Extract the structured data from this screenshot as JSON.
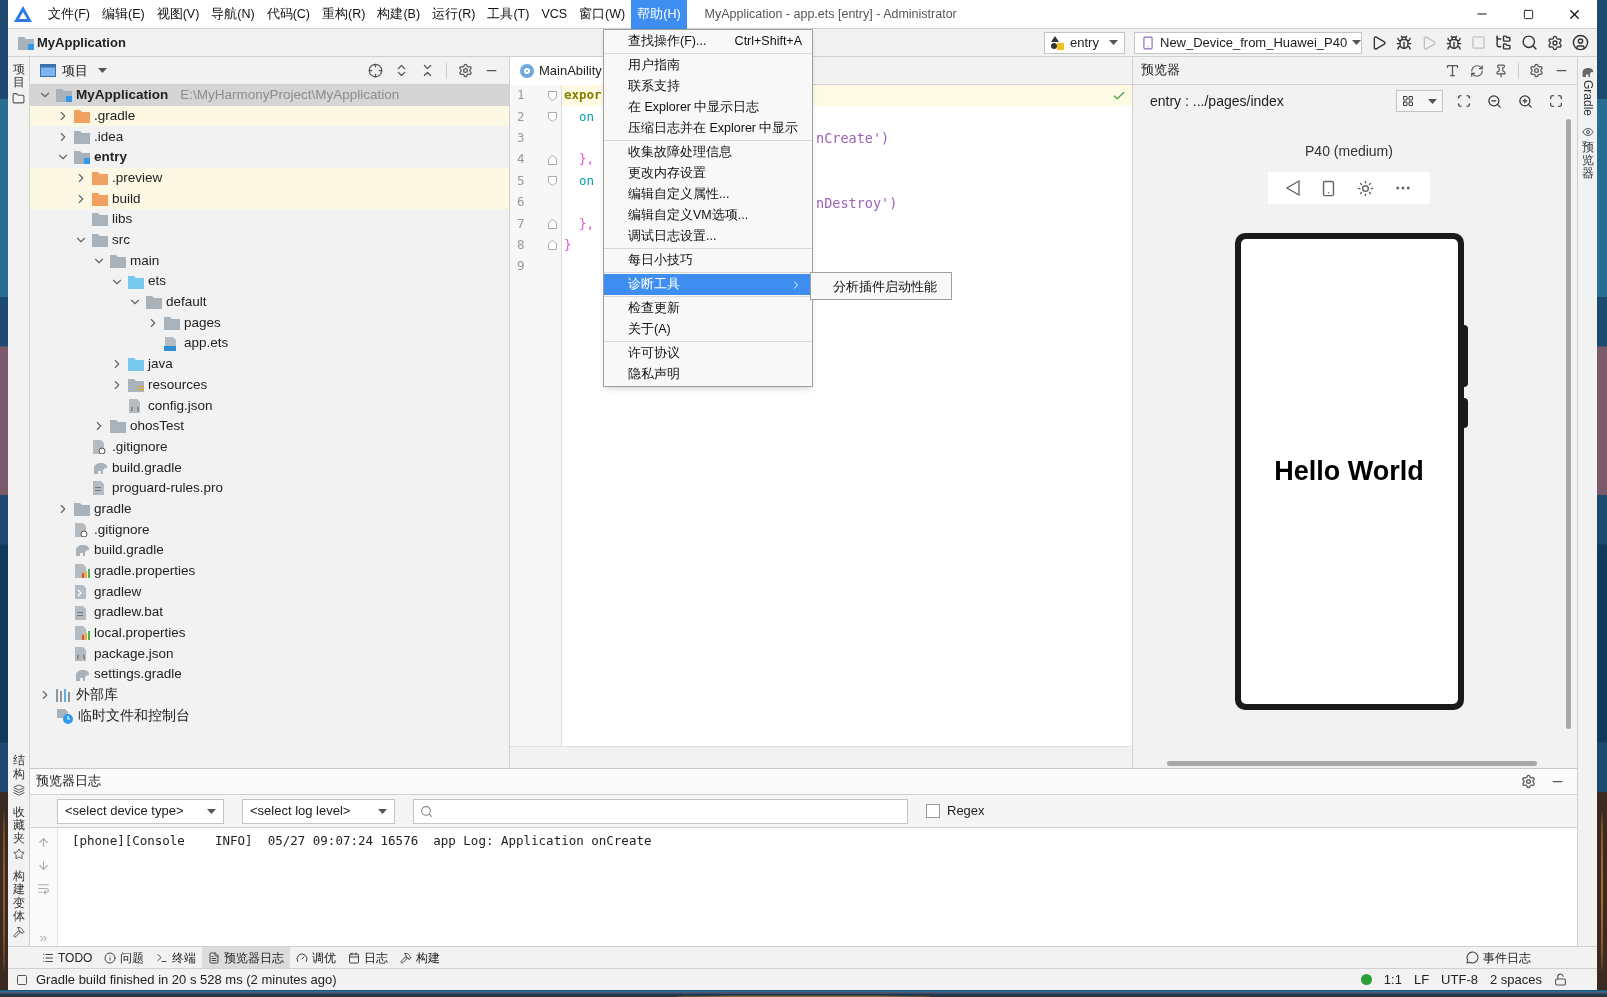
{
  "window": {
    "title": "MyApplication - app.ets [entry] - Administrator"
  },
  "menu_bar": [
    {
      "label": "文件(F)",
      "selected": false
    },
    {
      "label": "编辑(E)",
      "selected": false
    },
    {
      "label": "视图(V)",
      "selected": false
    },
    {
      "label": "导航(N)",
      "selected": false
    },
    {
      "label": "代码(C)",
      "selected": false
    },
    {
      "label": "重构(R)",
      "selected": false
    },
    {
      "label": "构建(B)",
      "selected": false
    },
    {
      "label": "运行(R)",
      "selected": false
    },
    {
      "label": "工具(T)",
      "selected": false
    },
    {
      "label": "VCS",
      "selected": false
    },
    {
      "label": "窗口(W)",
      "selected": false
    },
    {
      "label": "帮助(H)",
      "selected": true
    }
  ],
  "help_menu": [
    [
      {
        "label": "查找操作(F)...",
        "shortcut": "Ctrl+Shift+A",
        "selected": false
      }
    ],
    [
      {
        "label": "用户指南",
        "selected": false
      },
      {
        "label": "联系支持",
        "selected": false
      },
      {
        "label": "在 Explorer 中显示日志",
        "selected": false
      },
      {
        "label": "压缩日志并在 Explorer 中显示",
        "selected": false
      }
    ],
    [
      {
        "label": "收集故障处理信息",
        "selected": false
      },
      {
        "label": "更改内存设置",
        "selected": false
      },
      {
        "label": "编辑自定义属性...",
        "selected": false
      },
      {
        "label": "编辑自定义VM选项...",
        "selected": false
      },
      {
        "label": "调试日志设置...",
        "selected": false
      }
    ],
    [
      {
        "label": "每日小技巧",
        "selected": false
      }
    ],
    [
      {
        "label": "诊断工具",
        "selected": true,
        "submenu": [
          "分析插件启动性能"
        ]
      }
    ],
    [
      {
        "label": "检查更新",
        "selected": false
      },
      {
        "label": "关于(A)",
        "selected": false
      }
    ],
    [
      {
        "label": "许可协议",
        "selected": false
      },
      {
        "label": "隐私声明",
        "selected": false
      }
    ]
  ],
  "navigation": {
    "breadcrumb": "MyApplication",
    "module_selector": "entry",
    "device_selector": "New_Device_from_Huawei_P40"
  },
  "left_strip": [
    "项目",
    "结构",
    "收藏夹",
    "构建变体"
  ],
  "right_strip": [
    "Gradle",
    "预览器"
  ],
  "project_panel": {
    "title": "项目",
    "tree": [
      {
        "name": "MyApplication",
        "path": "E:\\MyHarmonyProject\\MyApplication",
        "kind": "module",
        "expanded": true,
        "selected": true,
        "excluded": false,
        "children": [
          {
            "name": ".gradle",
            "kind": "folder-excluded",
            "expanded": false,
            "selected": false,
            "excluded": true
          },
          {
            "name": ".idea",
            "kind": "folder",
            "expanded": false,
            "selected": false,
            "excluded": false
          },
          {
            "name": "entry",
            "kind": "module",
            "expanded": true,
            "selected": false,
            "excluded": false,
            "children": [
              {
                "name": ".preview",
                "kind": "folder-excluded",
                "expanded": false,
                "selected": false,
                "excluded": true
              },
              {
                "name": "build",
                "kind": "folder-excluded",
                "expanded": false,
                "selected": false,
                "excluded": true
              },
              {
                "name": "libs",
                "kind": "folder",
                "selected": false,
                "excluded": false
              },
              {
                "name": "src",
                "kind": "folder",
                "expanded": true,
                "selected": false,
                "excluded": false,
                "children": [
                  {
                    "name": "main",
                    "kind": "folder",
                    "expanded": true,
                    "selected": false,
                    "excluded": false,
                    "children": [
                      {
                        "name": "ets",
                        "kind": "folder-source",
                        "expanded": true,
                        "selected": false,
                        "excluded": false,
                        "children": [
                          {
                            "name": "default",
                            "kind": "folder",
                            "expanded": true,
                            "selected": false,
                            "excluded": false,
                            "children": [
                              {
                                "name": "pages",
                                "kind": "folder",
                                "expanded": false,
                                "selected": false,
                                "excluded": false
                              },
                              {
                                "name": "app.ets",
                                "kind": "file-ets",
                                "selected": false,
                                "excluded": false
                              }
                            ]
                          }
                        ]
                      },
                      {
                        "name": "java",
                        "kind": "folder-source",
                        "expanded": false,
                        "selected": false,
                        "excluded": false
                      },
                      {
                        "name": "resources",
                        "kind": "folder-resources",
                        "expanded": false,
                        "selected": false,
                        "excluded": false
                      },
                      {
                        "name": "config.json",
                        "kind": "file-config",
                        "selected": false,
                        "excluded": false
                      }
                    ]
                  },
                  {
                    "name": "ohosTest",
                    "kind": "folder",
                    "expanded": false,
                    "selected": false,
                    "excluded": false
                  }
                ]
              },
              {
                "name": ".gitignore",
                "kind": "file-ignore",
                "selected": false,
                "excluded": false
              },
              {
                "name": "build.gradle",
                "kind": "file-gradle",
                "selected": false,
                "excluded": false
              },
              {
                "name": "proguard-rules.pro",
                "kind": "file-text",
                "selected": false,
                "excluded": false
              }
            ]
          },
          {
            "name": "gradle",
            "kind": "folder",
            "expanded": false,
            "selected": false,
            "excluded": false
          },
          {
            "name": ".gitignore",
            "kind": "file-ignore",
            "selected": false,
            "excluded": false
          },
          {
            "name": "build.gradle",
            "kind": "file-gradle",
            "selected": false,
            "excluded": false
          },
          {
            "name": "gradle.properties",
            "kind": "file-props",
            "selected": false,
            "excluded": false
          },
          {
            "name": "gradlew",
            "kind": "file-script",
            "selected": false,
            "excluded": false
          },
          {
            "name": "gradlew.bat",
            "kind": "file-text",
            "selected": false,
            "excluded": false
          },
          {
            "name": "local.properties",
            "kind": "file-props",
            "selected": false,
            "excluded": false
          },
          {
            "name": "package.json",
            "kind": "file-config",
            "selected": false,
            "excluded": false
          },
          {
            "name": "settings.gradle",
            "kind": "file-gradle",
            "selected": false,
            "excluded": false
          }
        ]
      },
      {
        "name": "外部库",
        "kind": "library",
        "expanded": false,
        "selected": false,
        "excluded": false
      },
      {
        "name": "临时文件和控制台",
        "kind": "scratch",
        "selected": false,
        "excluded": false
      }
    ]
  },
  "editor": {
    "tab": "MainAbility",
    "lines": [
      {
        "number": "1",
        "current": true,
        "kind": "fold-start",
        "left": {
          "text": "expor",
          "kind": "keyword"
        }
      },
      {
        "number": "2",
        "current": false,
        "kind": "fold-start",
        "left": {
          "text": "  on",
          "kind": "member"
        }
      },
      {
        "number": "3",
        "current": false,
        "kind": "plain",
        "right": {
          "text": "nCreate')",
          "kind": "string"
        }
      },
      {
        "number": "4",
        "current": false,
        "kind": "fold-end",
        "left": {
          "text": "  },",
          "kind": "brace"
        }
      },
      {
        "number": "5",
        "current": false,
        "kind": "fold-start",
        "left": {
          "text": "  on",
          "kind": "member"
        }
      },
      {
        "number": "6",
        "current": false,
        "kind": "plain",
        "right": {
          "text": "nDestroy')",
          "kind": "string"
        }
      },
      {
        "number": "7",
        "current": false,
        "kind": "fold-end",
        "left": {
          "text": "  },",
          "kind": "brace"
        }
      },
      {
        "number": "8",
        "current": false,
        "kind": "fold-end",
        "left": {
          "text": "}",
          "kind": "brace"
        }
      },
      {
        "number": "9",
        "current": false,
        "kind": "plain"
      }
    ]
  },
  "preview": {
    "title": "预览器",
    "page": "entry : .../pages/index",
    "device": "P40 (medium)",
    "screen_text": "Hello World"
  },
  "log_panel": {
    "title": "预览器日志",
    "device_filter": "<select device type>",
    "level_filter": "<select log level>",
    "regex": {
      "label": "Regex",
      "checked": false
    },
    "lines": [
      "[phone][Console    INFO]  05/27 09:07:24 16576  app Log: Application onCreate"
    ]
  },
  "tool_tabs": [
    {
      "label": "TODO",
      "kind": "list",
      "selected": false
    },
    {
      "label": "问题",
      "kind": "problems",
      "selected": false
    },
    {
      "label": "终端",
      "kind": "terminal",
      "selected": false
    },
    {
      "label": "预览器日志",
      "kind": "log",
      "selected": true
    },
    {
      "label": "调优",
      "kind": "profiler",
      "selected": false
    },
    {
      "label": "日志",
      "kind": "hilog",
      "selected": false
    },
    {
      "label": "构建",
      "kind": "build",
      "selected": false
    }
  ],
  "event_log": "事件日志",
  "status_bar": {
    "message": "Gradle build finished in 20 s 528 ms (2 minutes ago)",
    "items": [
      "1:1",
      "LF",
      "UTF-8",
      "2 spaces"
    ]
  }
}
